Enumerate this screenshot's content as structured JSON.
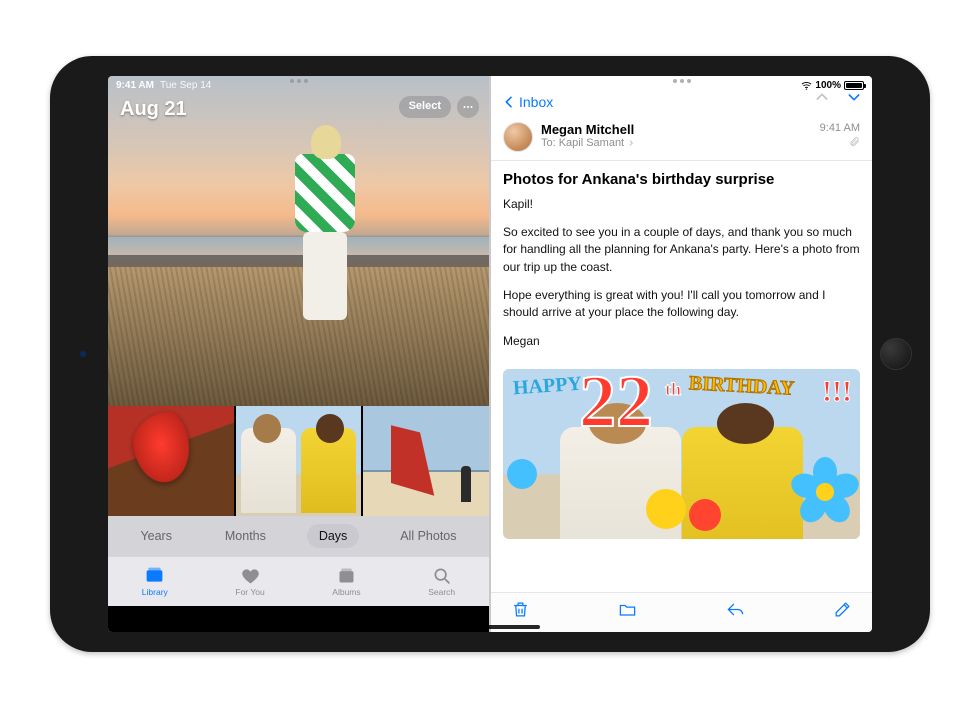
{
  "status": {
    "time": "9:41 AM",
    "date": "Tue Sep 14",
    "wifi": "wifi-icon",
    "battery_pct": "100%"
  },
  "photos": {
    "hero_title": "Aug 21",
    "select_label": "Select",
    "segments": [
      "Years",
      "Months",
      "Days",
      "All Photos"
    ],
    "active_segment": "Days",
    "tabs": [
      {
        "label": "Library",
        "icon": "library-icon",
        "active": true
      },
      {
        "label": "For You",
        "icon": "foryou-icon",
        "active": false
      },
      {
        "label": "Albums",
        "icon": "albums-icon",
        "active": false
      },
      {
        "label": "Search",
        "icon": "search-icon",
        "active": false
      }
    ]
  },
  "mail": {
    "back_label": "Inbox",
    "from": "Megan Mitchell",
    "to_label": "To:",
    "to_name": "Kapil Samant",
    "time": "9:41 AM",
    "subject": "Photos for Ankana's birthday surprise",
    "greeting": "Kapil!",
    "p1": "So excited to see you in a couple of days, and thank you so much for handling all the planning for Ankana's party. Here's a photo from our trip up the coast.",
    "p2": "Hope everything is great with you! I'll call you tomorrow and I should arrive at your place the following day.",
    "signoff": "Megan",
    "overlay": {
      "happy": "HAPPY",
      "num": "22",
      "th": "th",
      "bday": "BIRTHDAY",
      "excl": "!!!"
    },
    "toolbar_icons": [
      "trash-icon",
      "folder-icon",
      "reply-icon",
      "compose-icon"
    ]
  }
}
